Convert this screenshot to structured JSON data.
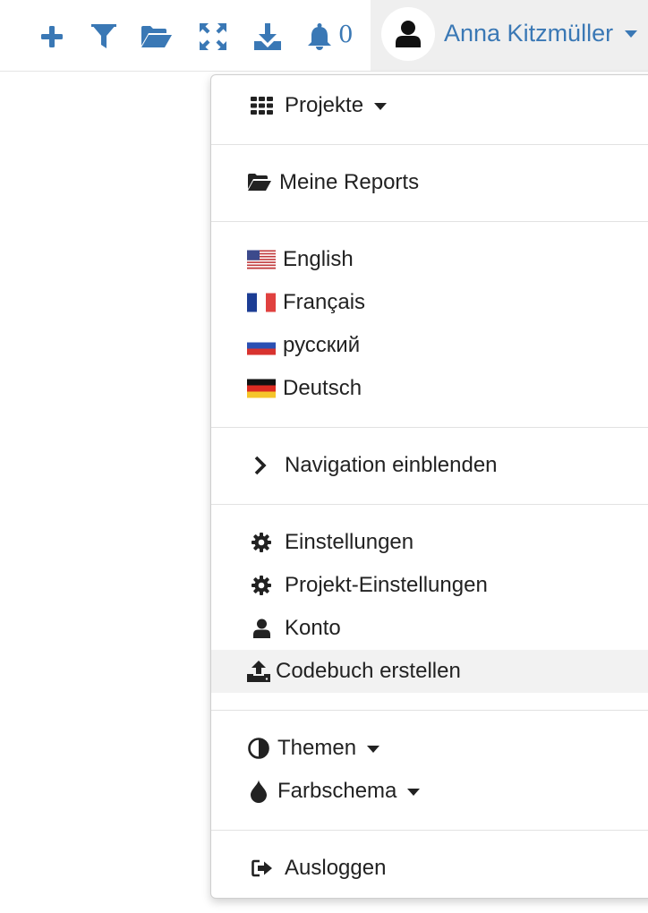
{
  "toolbar": {
    "icons": [
      "plus-icon",
      "filter-icon",
      "folder-open-icon",
      "expand-icon",
      "download-icon",
      "bell-icon"
    ],
    "notification_count": "0",
    "accent_color": "#3a78b5"
  },
  "user": {
    "name": "Anna Kitzmüller",
    "avatar_icon": "user-icon"
  },
  "menu": {
    "projects": "Projekte",
    "my_reports": "Meine Reports",
    "languages": [
      {
        "label": "English",
        "flag": "us-flag-icon"
      },
      {
        "label": "Français",
        "flag": "fr-flag-icon"
      },
      {
        "label": "русский",
        "flag": "ru-flag-icon"
      },
      {
        "label": "Deutsch",
        "flag": "de-flag-icon"
      }
    ],
    "show_navigation": "Navigation einblenden",
    "settings": "Einstellungen",
    "project_settings": "Projekt-Einstellungen",
    "account": "Konto",
    "create_codebook": "Codebuch erstellen",
    "themes": "Themen",
    "color_scheme": "Farbschema",
    "logout": "Ausloggen",
    "highlighted_item": "create_codebook"
  }
}
